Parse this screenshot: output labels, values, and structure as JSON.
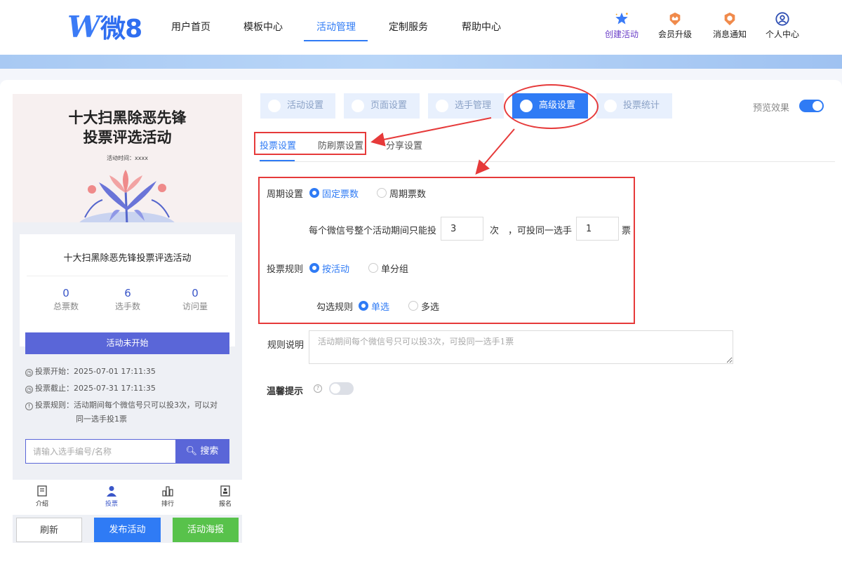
{
  "header": {
    "logo_mark": "W",
    "logo_text": "微8",
    "nav": [
      "用户首页",
      "模板中心",
      "活动管理",
      "定制服务",
      "帮助中心"
    ],
    "tools": [
      "创建活动",
      "会员升级",
      "消息通知",
      "个人中心"
    ]
  },
  "preview": {
    "poster_title_line1": "十大扫黑除恶先锋",
    "poster_title_line2": "投票评选活动",
    "poster_time": "活动时间：xxxx",
    "activity_title": "十大扫黑除恶先锋投票评选活动",
    "stats": [
      {
        "value": "0",
        "label": "总票数"
      },
      {
        "value": "6",
        "label": "选手数"
      },
      {
        "value": "0",
        "label": "访问量"
      }
    ],
    "status": "活动未开始",
    "vote_start": "投票开始：2025-07-01 17:11:35",
    "vote_end": "投票截止：2025-07-31 17:11:35",
    "vote_rule_line1": "投票规则：活动期间每个微信号只可以投3次，可以对",
    "vote_rule_line2": "同一选手投1票",
    "search_placeholder": "请输入选手编号/名称",
    "search_button": "搜索",
    "tabbar": [
      "介绍",
      "投票",
      "排行",
      "报名"
    ]
  },
  "actions": {
    "refresh": "刷新",
    "publish": "发布活动",
    "poster": "活动海报"
  },
  "settings": {
    "tabs": [
      "活动设置",
      "页面设置",
      "选手管理",
      "高级设置",
      "投票统计"
    ],
    "preview_label": "预览效果",
    "sub_tabs": [
      "投票设置",
      "防刷票设置",
      "分享设置"
    ],
    "period_label": "周期设置",
    "period_options": [
      "固定票数",
      "周期票数"
    ],
    "limit_prefix": "每个微信号整个活动期间只能投",
    "limit_times": "3",
    "limit_unit": "次",
    "limit_mid": "，可投同一选手",
    "limit_votes": "1",
    "limit_suffix": "票",
    "vote_rule_label": "投票规则",
    "vote_rule_options": [
      "按活动",
      "单分组"
    ],
    "select_rule_label": "勾选规则",
    "select_rule_options": [
      "单选",
      "多选"
    ],
    "rule_desc_label": "规则说明",
    "rule_desc_placeholder": "活动期间每个微信号只可以投3次，可投同一选手1票",
    "tip_label": "温馨提示",
    "tip_help": "?"
  }
}
